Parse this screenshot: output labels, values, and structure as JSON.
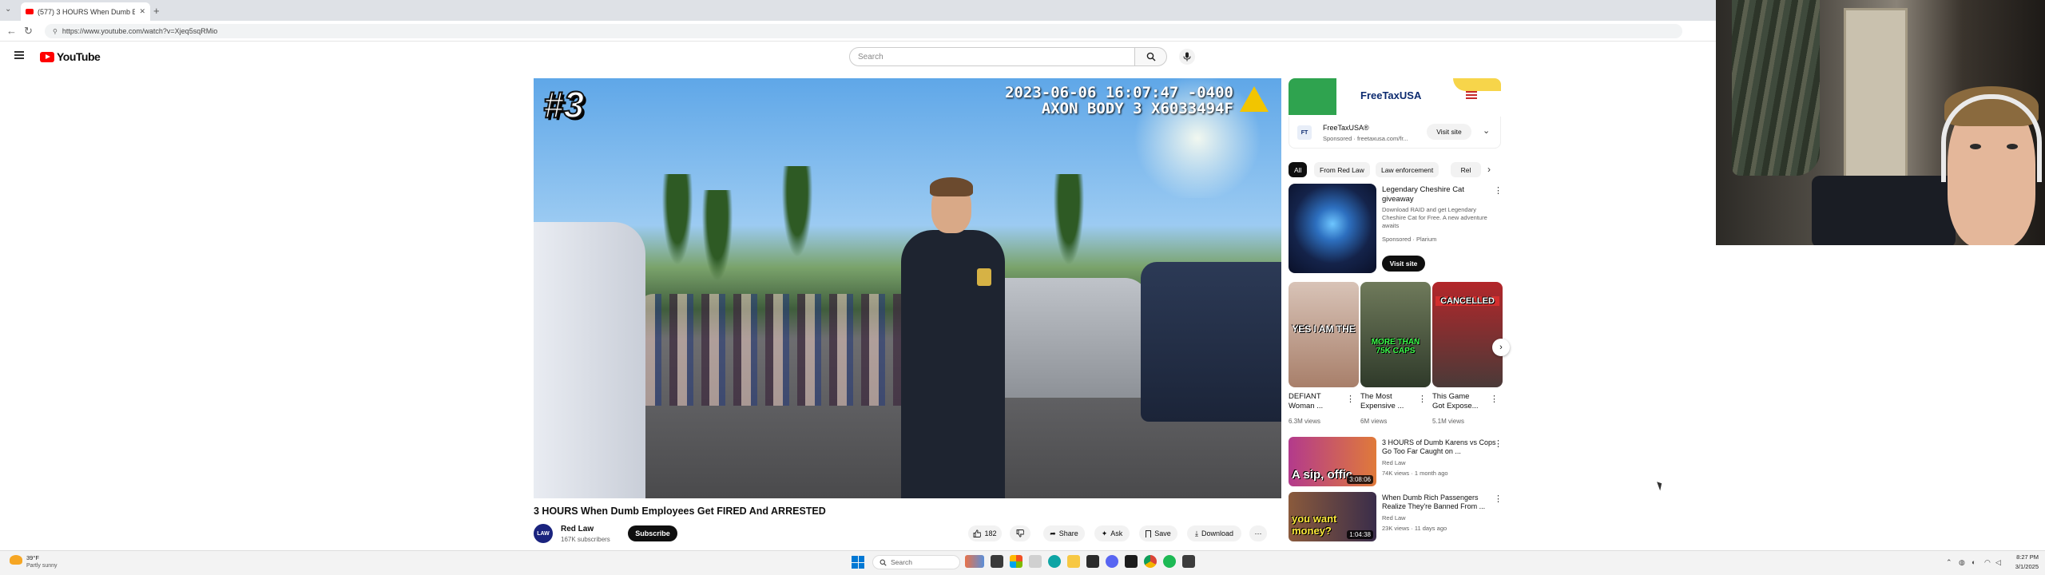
{
  "browser": {
    "tab_title": "(577) 3 HOURS When Dumb E",
    "new_tab": "+",
    "url": "https://www.youtube.com/watch?v=Xjeq5sqRMio"
  },
  "header": {
    "logo_text": "YouTube",
    "search_placeholder": "Search"
  },
  "video": {
    "overlay_number": "#3",
    "timestamp_line1": "2023-06-06 16:07:47 -0400",
    "timestamp_line2": "AXON BODY 3 X6033494F",
    "title": "3 HOURS When Dumb Employees Get FIRED And ARRESTED",
    "channel": "Red Law",
    "channel_avatar": "LAW",
    "subscribers": "167K subscribers",
    "subscribe_label": "Subscribe",
    "likes": "182",
    "share_label": "Share",
    "ask_label": "Ask",
    "save_label": "Save",
    "download_label": "Download",
    "more_label": "⋯"
  },
  "sidebar": {
    "ad": {
      "brand": "FreeTaxUSA",
      "name": "FreeTaxUSA®",
      "sponsored": "Sponsored · freetaxusa.com/fr...",
      "icon_text": "FT",
      "visit_label": "Visit site"
    },
    "chips": [
      "All",
      "From Red Law",
      "Law enforcement",
      "Rel"
    ],
    "promo": {
      "title": "Legendary Cheshire Cat giveaway",
      "description": "Download RAID and get Legendary Cheshire Cat for Free. A new adventure awaits",
      "sponsored": "Sponsored · Plarium",
      "visit_label": "Visit site"
    },
    "shorts": [
      {
        "caption": "YES I AM THE",
        "title": "DEFIANT Woman ...",
        "views": "6.3M views"
      },
      {
        "caption": "MORE THAN 75K CAPS",
        "title": "The Most Expensive ...",
        "views": "6M views"
      },
      {
        "caption": "CANCELLED",
        "title": "This Game Got Expose...",
        "views": "5.1M views"
      }
    ],
    "recommended": [
      {
        "caption": "A sip, offic",
        "duration": "3:08:06",
        "title": "3 HOURS of Dumb Karens vs Cops Go Too Far Caught on ...",
        "channel": "Red Law",
        "meta": "74K views · 1 month ago"
      },
      {
        "caption": "you want money?",
        "duration": "1:04:38",
        "title": "When Dumb Rich Passengers Realize They're Banned From ...",
        "channel": "Red Law",
        "meta": "23K views · 11 days ago"
      }
    ]
  },
  "taskbar": {
    "weather_temp": "39°F",
    "weather_desc": "Partly sunny",
    "search_label": "Search",
    "time": "8:27 PM",
    "date": "3/1/2025"
  },
  "colors": {
    "youtube_red": "#ff0000",
    "subscribe_bg": "#0f0f0f",
    "accent_blue": "#0078d4"
  }
}
